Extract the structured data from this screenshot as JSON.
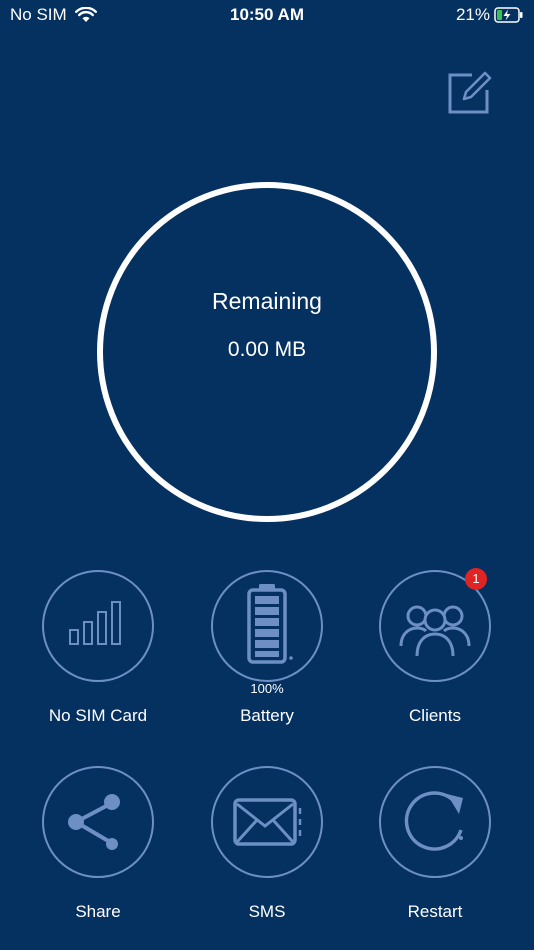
{
  "status_bar": {
    "carrier": "No SIM",
    "time": "10:50 AM",
    "battery_percent": "21%"
  },
  "header": {
    "edit_icon": "edit-icon"
  },
  "data_usage": {
    "title": "Remaining",
    "value": "0.00 MB"
  },
  "tiles": [
    {
      "label": "No SIM Card",
      "icon": "signal-bars-icon"
    },
    {
      "label": "Battery",
      "icon": "battery-icon",
      "sub": "100%"
    },
    {
      "label": "Clients",
      "icon": "users-icon",
      "badge": "1"
    },
    {
      "label": "Share",
      "icon": "share-icon"
    },
    {
      "label": "SMS",
      "icon": "envelope-icon"
    },
    {
      "label": "Restart",
      "icon": "restart-icon"
    }
  ],
  "colors": {
    "background": "#053161",
    "icon_outline": "#6d8fc4",
    "badge": "#e02424",
    "battery_charging": "#3cc24b"
  }
}
